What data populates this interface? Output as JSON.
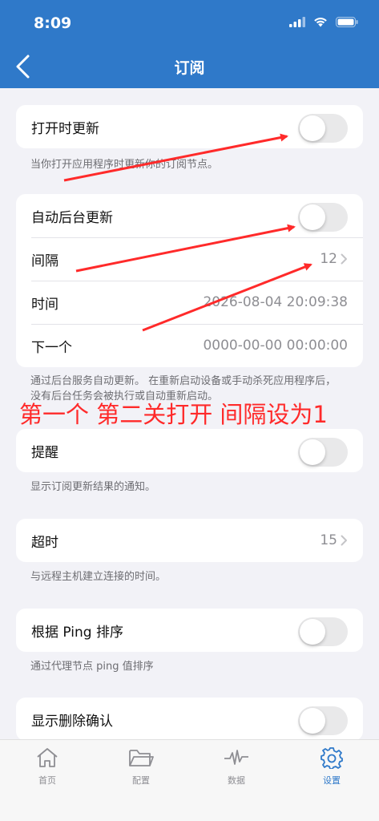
{
  "status": {
    "time": "8:09"
  },
  "nav": {
    "title": "订阅"
  },
  "sections": {
    "open_update": {
      "label": "打开时更新",
      "on": false,
      "note": "当你打开应用程序时更新你的订阅节点。"
    },
    "auto_bg": {
      "label": "自动后台更新",
      "on": false
    },
    "interval": {
      "label": "间隔",
      "value": "12"
    },
    "time": {
      "label": "时间",
      "value": "2026-08-04 20:09:38"
    },
    "next": {
      "label": "下一个",
      "value": "0000-00-00 00:00:00"
    },
    "auto_note": "通过后台服务自动更新。 在重新启动设备或手动杀死应用程序后，没有后台任务会被执行或自动重新启动。",
    "reminder": {
      "label": "提醒",
      "on": false,
      "note": "显示订阅更新结果的通知。"
    },
    "timeout": {
      "label": "超时",
      "value": "15",
      "note": "与远程主机建立连接的时间。"
    },
    "ping_sort": {
      "label": "根据 Ping 排序",
      "on": false,
      "note": "通过代理节点 ping 值排序"
    },
    "delete_confirm": {
      "label": "显示删除确认",
      "on": false
    }
  },
  "annotation": "第一个  第二关打开  间隔设为1",
  "tabs": [
    {
      "label": "首页",
      "icon": "home-icon",
      "active": false
    },
    {
      "label": "配置",
      "icon": "folder-icon",
      "active": false
    },
    {
      "label": "数据",
      "icon": "pulse-icon",
      "active": false
    },
    {
      "label": "设置",
      "icon": "gear-icon",
      "active": true
    }
  ],
  "colors": {
    "nav": "#2f79c9",
    "active_tab": "#2f79c9",
    "annotation": "#ff2a2a"
  }
}
